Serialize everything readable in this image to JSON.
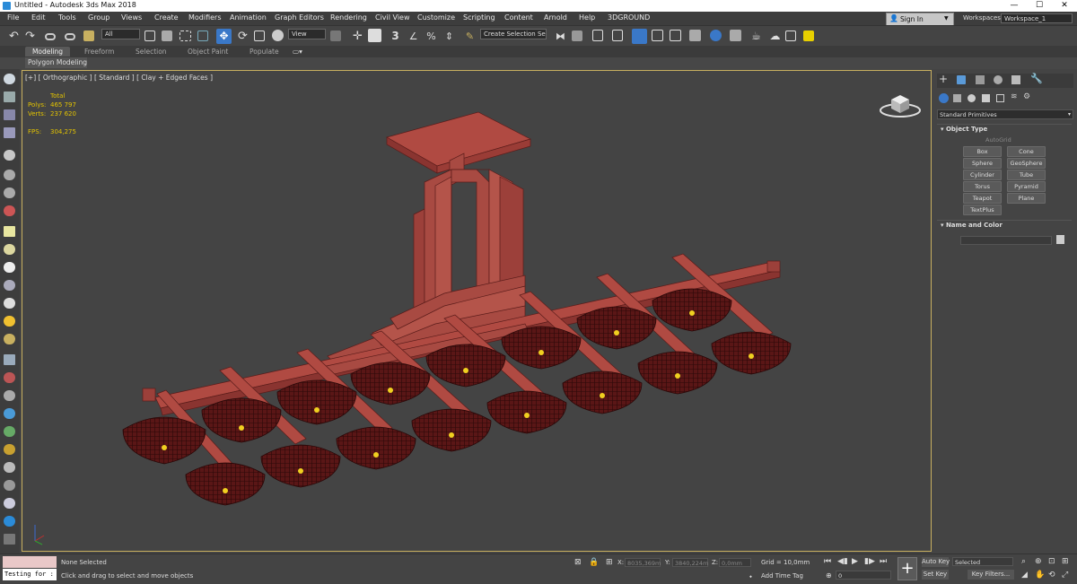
{
  "window": {
    "title": "Untitled - Autodesk 3ds Max 2018",
    "minimize": "—",
    "maximize": "☐",
    "close": "✕"
  },
  "menu": [
    "File",
    "Edit",
    "Tools",
    "Group",
    "Views",
    "Create",
    "Modifiers",
    "Animation",
    "Graph Editors",
    "Rendering",
    "Civil View",
    "Customize",
    "Scripting",
    "Content",
    "Arnold",
    "Help",
    "3DGROUND"
  ],
  "account": {
    "sign_in": "Sign In",
    "workspaces_label": "Workspaces:",
    "workspace": "Workspace_1"
  },
  "toolbar": {
    "filter": "All",
    "view": "View",
    "selection_set": "Create Selection Se"
  },
  "ribbon": {
    "tabs": [
      "Modeling",
      "Freeform",
      "Selection",
      "Object Paint",
      "Populate"
    ],
    "subtab": "Polygon Modeling"
  },
  "viewport": {
    "label": "[+] [ Orthographic ] [ Standard ] [ Clay + Edged Faces ]",
    "stats": {
      "total_label": "Total",
      "polys_label": "Polys:",
      "polys": "465 797",
      "verts_label": "Verts:",
      "verts": "237 620",
      "fps_label": "FPS:",
      "fps": "304,275"
    }
  },
  "command_panel": {
    "category": "Standard Primitives",
    "object_type_title": "Object Type",
    "autogrid": "AutoGrid",
    "buttons": [
      "Box",
      "Cone",
      "Sphere",
      "GeoSphere",
      "Cylinder",
      "Tube",
      "Torus",
      "Pyramid",
      "Teapot",
      "Plane",
      "TextPlus"
    ],
    "name_color_title": "Name and Color"
  },
  "status": {
    "maxscript": "Testing for :",
    "selection": "None Selected",
    "prompt": "Click and drag to select and move objects",
    "x_label": "X:",
    "x": "8035,369m",
    "y_label": "Y:",
    "y": "3840,224m",
    "z_label": "Z:",
    "z": "0,0mm",
    "grid": "Grid = 10,0mm",
    "add_time_tag": "Add Time Tag",
    "autokey": "Auto Key",
    "setkey": "Set Key",
    "selected": "Selected",
    "key_filters": "Key Filters...",
    "frame": "0"
  },
  "colors": {
    "model": "#a84a42",
    "model_dark": "#6e2420",
    "shade": "#4a1010",
    "bulb": "#f0d020",
    "viewport_border": "#c8b060",
    "accent": "#2b8bd8"
  }
}
